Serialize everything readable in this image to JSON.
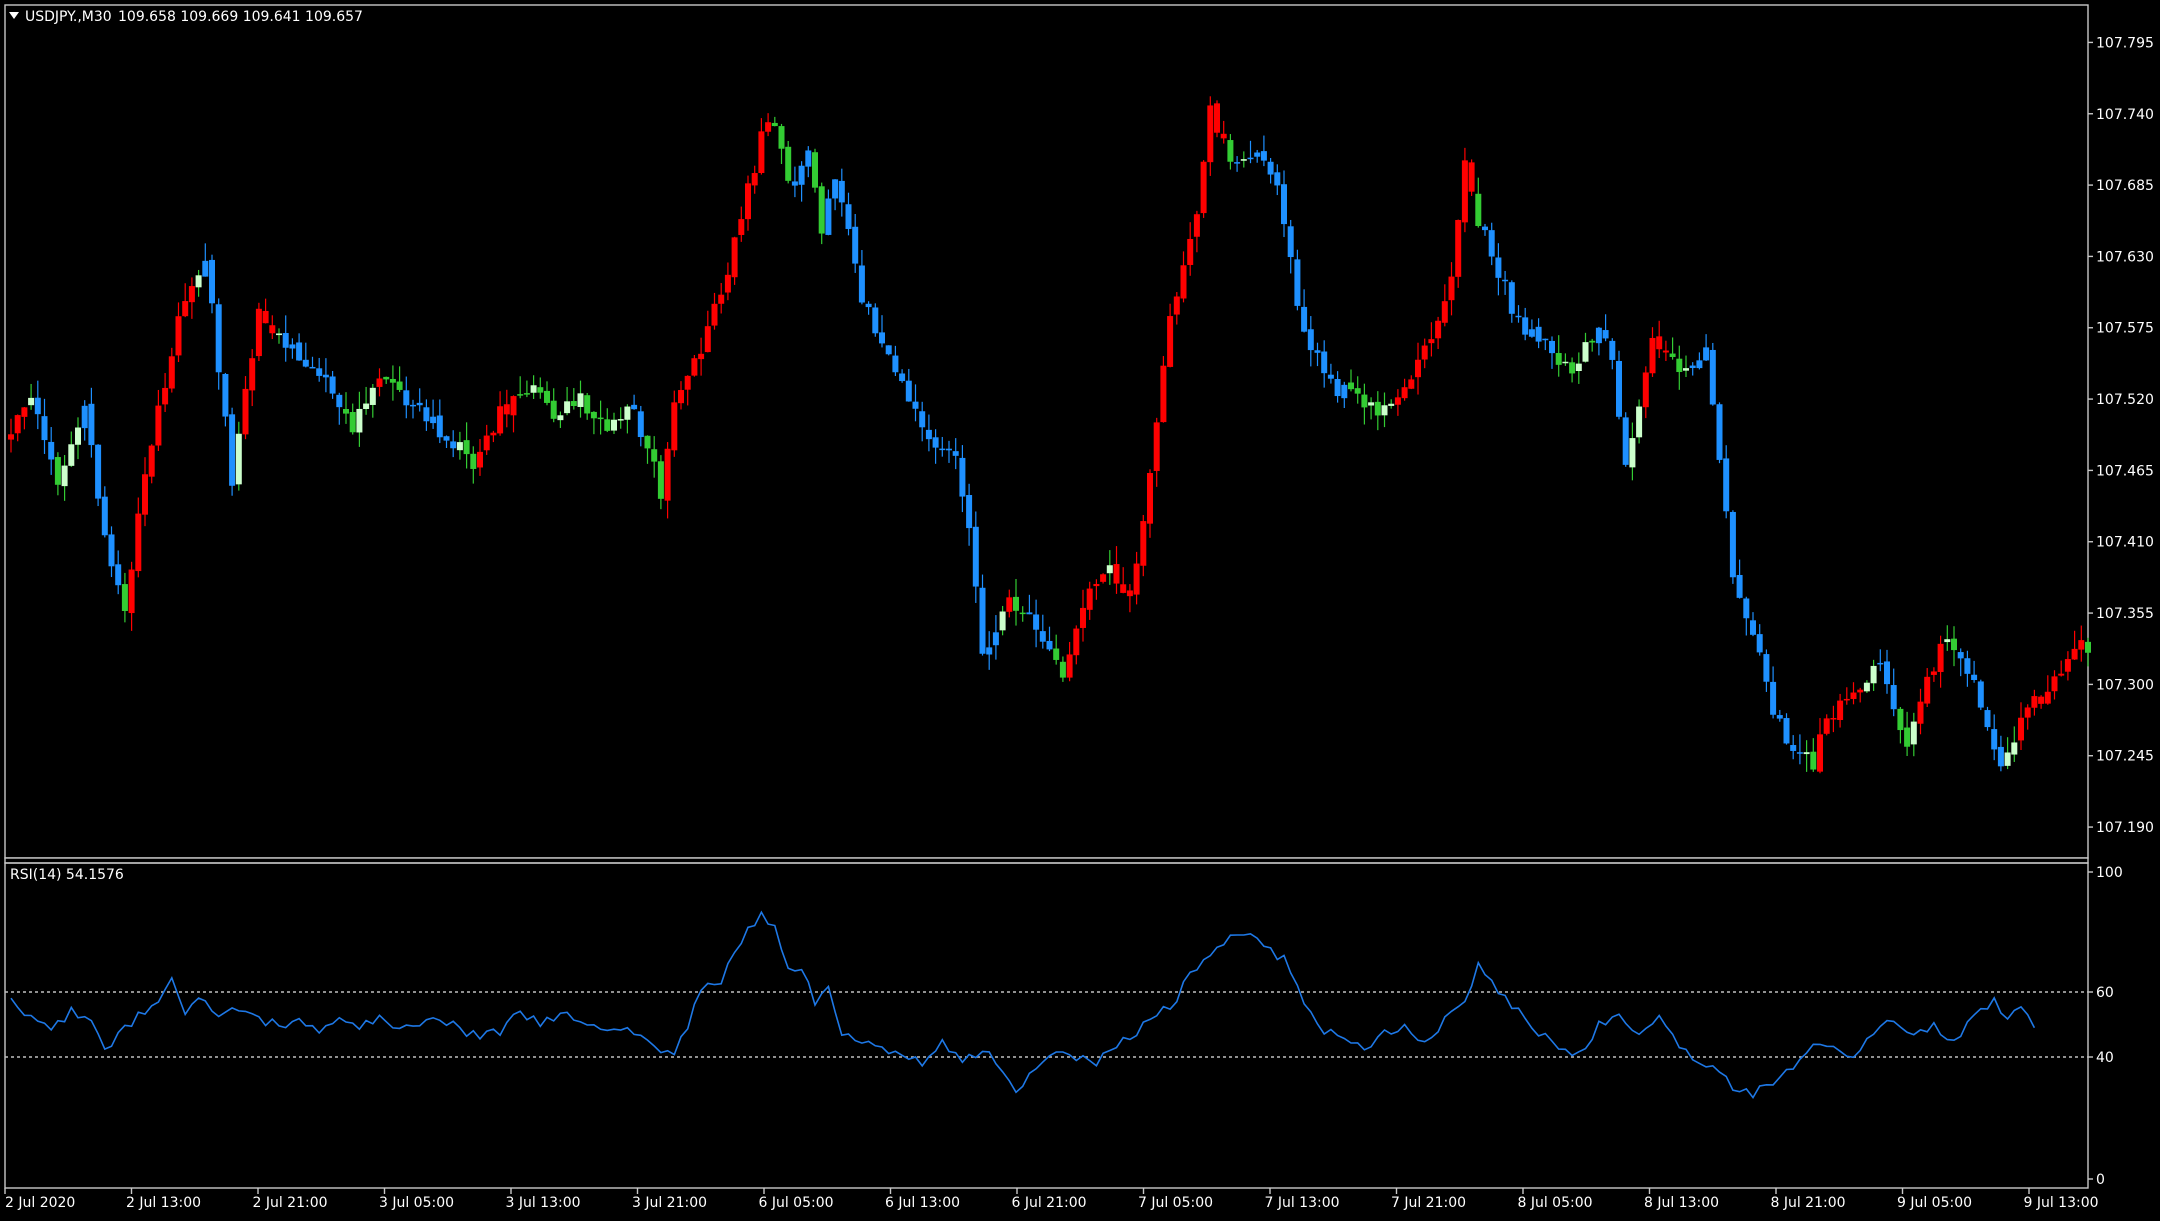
{
  "header": {
    "symbol": "USDJPY.,M30",
    "ohlc": "109.658 109.669 109.641 109.657",
    "menu_icon": "triangle-down-icon"
  },
  "indicator": {
    "label": "RSI(14) 54.1576",
    "levels": [
      60,
      40
    ],
    "scale_labels": [
      "100",
      "60",
      "40",
      "0"
    ]
  },
  "colors": {
    "bg": "#000000",
    "bull_strong": "#ccffcc",
    "bull_weak": "#33cc33",
    "bear_strong": "#ff0000",
    "bear_weak": "#1e90ff",
    "rsi_line": "#1e78e6",
    "frame": "#c8c8c8"
  },
  "chart_data": {
    "type": "candlestick",
    "timeframe": "M30",
    "y_ticks": [
      "107.795",
      "107.740",
      "107.685",
      "107.630",
      "107.575",
      "107.520",
      "107.465",
      "107.410",
      "107.355",
      "107.300",
      "107.245",
      "107.190"
    ],
    "x_ticks": [
      "2 Jul 2020",
      "2 Jul 13:00",
      "2 Jul 21:00",
      "3 Jul 05:00",
      "3 Jul 13:00",
      "3 Jul 21:00",
      "6 Jul 05:00",
      "6 Jul 13:00",
      "6 Jul 21:00",
      "7 Jul 05:00",
      "7 Jul 13:00",
      "7 Jul 21:00",
      "8 Jul 05:00",
      "8 Jul 13:00",
      "8 Jul 21:00",
      "9 Jul 05:00",
      "9 Jul 13:00"
    ],
    "ylim": [
      107.17,
      107.82
    ],
    "rsi_ylim": [
      0,
      100
    ],
    "series_path": [
      [
        0,
        107.49
      ],
      [
        4,
        107.52
      ],
      [
        8,
        107.45
      ],
      [
        12,
        107.51
      ],
      [
        16,
        107.39
      ],
      [
        18,
        107.36
      ],
      [
        22,
        107.49
      ],
      [
        26,
        107.58
      ],
      [
        30,
        107.63
      ],
      [
        34,
        107.46
      ],
      [
        38,
        107.59
      ],
      [
        44,
        107.55
      ],
      [
        48,
        107.53
      ],
      [
        52,
        107.5
      ],
      [
        56,
        107.54
      ],
      [
        60,
        107.52
      ],
      [
        66,
        107.49
      ],
      [
        70,
        107.47
      ],
      [
        74,
        107.51
      ],
      [
        78,
        107.53
      ],
      [
        82,
        107.51
      ],
      [
        86,
        107.52
      ],
      [
        90,
        107.5
      ],
      [
        94,
        107.51
      ],
      [
        96,
        107.48
      ],
      [
        98,
        107.45
      ],
      [
        100,
        107.52
      ],
      [
        104,
        107.56
      ],
      [
        108,
        107.62
      ],
      [
        112,
        107.7
      ],
      [
        114,
        107.74
      ],
      [
        118,
        107.68
      ],
      [
        120,
        107.71
      ],
      [
        122,
        107.65
      ],
      [
        124,
        107.69
      ],
      [
        128,
        107.6
      ],
      [
        134,
        107.53
      ],
      [
        138,
        107.49
      ],
      [
        142,
        107.48
      ],
      [
        144,
        107.42
      ],
      [
        146,
        107.32
      ],
      [
        150,
        107.37
      ],
      [
        154,
        107.34
      ],
      [
        158,
        107.31
      ],
      [
        160,
        107.35
      ],
      [
        164,
        107.39
      ],
      [
        168,
        107.37
      ],
      [
        170,
        107.43
      ],
      [
        174,
        107.58
      ],
      [
        178,
        107.66
      ],
      [
        180,
        107.74
      ],
      [
        184,
        107.7
      ],
      [
        188,
        107.71
      ],
      [
        190,
        107.68
      ],
      [
        194,
        107.57
      ],
      [
        198,
        107.53
      ],
      [
        202,
        107.52
      ],
      [
        206,
        107.51
      ],
      [
        210,
        107.54
      ],
      [
        214,
        107.58
      ],
      [
        216,
        107.62
      ],
      [
        218,
        107.7
      ],
      [
        220,
        107.66
      ],
      [
        222,
        107.63
      ],
      [
        226,
        107.58
      ],
      [
        230,
        107.56
      ],
      [
        234,
        107.54
      ],
      [
        238,
        107.58
      ],
      [
        240,
        107.55
      ],
      [
        242,
        107.47
      ],
      [
        246,
        107.57
      ],
      [
        250,
        107.54
      ],
      [
        254,
        107.56
      ],
      [
        256,
        107.48
      ],
      [
        258,
        107.38
      ],
      [
        262,
        107.32
      ],
      [
        264,
        107.28
      ],
      [
        266,
        107.26
      ],
      [
        270,
        107.24
      ],
      [
        272,
        107.27
      ],
      [
        276,
        107.3
      ],
      [
        280,
        107.31
      ],
      [
        284,
        107.25
      ],
      [
        286,
        107.29
      ],
      [
        290,
        107.34
      ],
      [
        294,
        107.3
      ],
      [
        298,
        107.24
      ],
      [
        302,
        107.28
      ],
      [
        306,
        107.3
      ],
      [
        310,
        107.33
      ]
    ],
    "rsi_path": [
      [
        0,
        58
      ],
      [
        3,
        52
      ],
      [
        6,
        48
      ],
      [
        9,
        55
      ],
      [
        12,
        52
      ],
      [
        14,
        42
      ],
      [
        17,
        49
      ],
      [
        20,
        55
      ],
      [
        22,
        58
      ],
      [
        24,
        66
      ],
      [
        26,
        55
      ],
      [
        28,
        58
      ],
      [
        31,
        54
      ],
      [
        34,
        56
      ],
      [
        37,
        52
      ],
      [
        40,
        50
      ],
      [
        43,
        52
      ],
      [
        46,
        48
      ],
      [
        49,
        53
      ],
      [
        52,
        50
      ],
      [
        55,
        52
      ],
      [
        58,
        48
      ],
      [
        61,
        50
      ],
      [
        64,
        52
      ],
      [
        67,
        49
      ],
      [
        70,
        46
      ],
      [
        73,
        48
      ],
      [
        76,
        55
      ],
      [
        79,
        50
      ],
      [
        82,
        54
      ],
      [
        85,
        52
      ],
      [
        88,
        48
      ],
      [
        91,
        50
      ],
      [
        94,
        47
      ],
      [
        97,
        42
      ],
      [
        99,
        40
      ],
      [
        101,
        50
      ],
      [
        103,
        62
      ],
      [
        106,
        65
      ],
      [
        109,
        78
      ],
      [
        112,
        86
      ],
      [
        114,
        82
      ],
      [
        116,
        70
      ],
      [
        118,
        68
      ],
      [
        120,
        58
      ],
      [
        122,
        62
      ],
      [
        124,
        48
      ],
      [
        127,
        45
      ],
      [
        130,
        42
      ],
      [
        133,
        40
      ],
      [
        136,
        38
      ],
      [
        139,
        44
      ],
      [
        142,
        38
      ],
      [
        145,
        42
      ],
      [
        148,
        36
      ],
      [
        150,
        28
      ],
      [
        153,
        36
      ],
      [
        156,
        42
      ],
      [
        159,
        40
      ],
      [
        162,
        38
      ],
      [
        165,
        44
      ],
      [
        168,
        48
      ],
      [
        171,
        54
      ],
      [
        174,
        58
      ],
      [
        176,
        68
      ],
      [
        179,
        72
      ],
      [
        182,
        78
      ],
      [
        185,
        80
      ],
      [
        188,
        74
      ],
      [
        190,
        72
      ],
      [
        193,
        58
      ],
      [
        196,
        48
      ],
      [
        199,
        46
      ],
      [
        202,
        42
      ],
      [
        205,
        48
      ],
      [
        208,
        50
      ],
      [
        211,
        44
      ],
      [
        214,
        52
      ],
      [
        217,
        58
      ],
      [
        219,
        70
      ],
      [
        222,
        60
      ],
      [
        225,
        55
      ],
      [
        228,
        48
      ],
      [
        231,
        42
      ],
      [
        234,
        40
      ],
      [
        237,
        50
      ],
      [
        240,
        54
      ],
      [
        243,
        46
      ],
      [
        246,
        52
      ],
      [
        249,
        44
      ],
      [
        252,
        38
      ],
      [
        255,
        36
      ],
      [
        257,
        30
      ],
      [
        260,
        28
      ],
      [
        263,
        32
      ],
      [
        266,
        36
      ],
      [
        269,
        44
      ],
      [
        272,
        42
      ],
      [
        275,
        40
      ],
      [
        278,
        48
      ],
      [
        281,
        52
      ],
      [
        284,
        46
      ],
      [
        287,
        50
      ],
      [
        290,
        44
      ],
      [
        293,
        54
      ],
      [
        296,
        58
      ],
      [
        298,
        52
      ],
      [
        300,
        56
      ],
      [
        303,
        48
      ]
    ]
  }
}
